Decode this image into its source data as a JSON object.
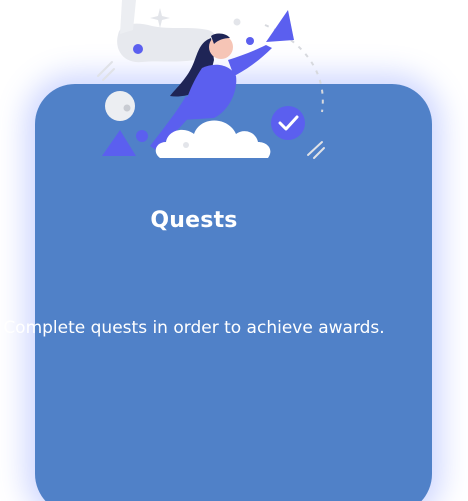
{
  "card": {
    "title": "Quests",
    "description": "Complete quests in order to achieve awards."
  },
  "colors": {
    "card_bg": "#5081c8",
    "accent": "#5b5fef",
    "cloud": "#ffffff"
  },
  "icons": [
    "quest-illustration",
    "checkmark-icon",
    "flag-triangle-icon",
    "sparkle-icon"
  ]
}
